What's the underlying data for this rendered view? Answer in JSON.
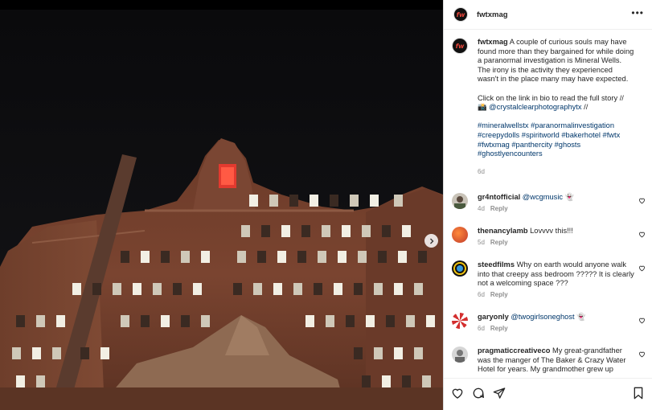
{
  "header": {
    "username": "fwtxmag",
    "avatar_text": "fw"
  },
  "caption": {
    "username": "fwtxmag",
    "text1": "A couple of curious souls may have found more than they bargained for while doing a paranormal investigation is Mineral Wells. The irony is the activity they experienced wasn't in the place many may have expected.",
    "text2a": "Click on the link in bio to read the full story //",
    "camera_emoji": "📸",
    "mention": "@crystalclearphotographytx",
    "text2b": " //",
    "hashtags": "#mineralwellstx #paranormalinvestigation #creepydolls #spiritworld #bakerhotel #fwtx #fwtxmag #panthercity #ghosts #ghostlyencounters",
    "time": "6d"
  },
  "comments": [
    {
      "username": "gr4ntofficial",
      "mention": "@wcgmusic",
      "text": " 👻",
      "time": "4d",
      "reply": "Reply",
      "avatar_icon": "person-avatar-icon"
    },
    {
      "username": "thenancylamb",
      "mention": "",
      "text": "Lovvvv this!!!",
      "time": "5d",
      "reply": "Reply",
      "avatar_icon": "orange-avatar-icon"
    },
    {
      "username": "steedfilms",
      "mention": "",
      "text": "Why on earth would anyone walk into that creepy ass bedroom ????? It is clearly not a welcoming space ???",
      "time": "6d",
      "reply": "Reply",
      "avatar_icon": "ring-avatar-icon"
    },
    {
      "username": "garyonly",
      "mention": "@twogirlsoneghost",
      "text": " 👻",
      "time": "6d",
      "reply": "Reply",
      "avatar_icon": "striped-avatar-icon"
    },
    {
      "username": "pragmaticcreativeco",
      "mention": "",
      "text": "My great-grandfather was the manger of The Baker & Crazy Water Hotel for years. My grandmother grew up",
      "time": "",
      "reply": "",
      "avatar_icon": "person-avatar-icon"
    }
  ],
  "actions": {
    "like": "heart-icon",
    "comment": "comment-icon",
    "share": "share-icon",
    "save": "bookmark-icon"
  },
  "colors": {
    "accent": "#e8463b",
    "link": "#00376b",
    "meta": "#8e8e8e"
  }
}
